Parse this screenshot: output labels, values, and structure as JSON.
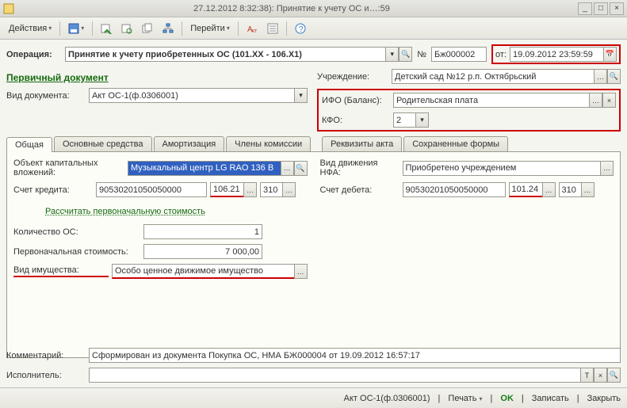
{
  "titlebar": {
    "left_fragment": "",
    "right_fragment": "27.12.2012 8:32:38): Принятие к учету ОС и…:59"
  },
  "toolbar": {
    "actions": "Действия",
    "goto": "Перейти"
  },
  "header": {
    "operation_label": "Операция:",
    "operation_value": "Принятие к учету приобретенных ОС (101.XX - 106.X1)",
    "num_label": "№",
    "num_value": "Бж000002",
    "from_label": "от:",
    "from_value": "19.09.2012 23:59:59"
  },
  "primary_doc_title": "Первичный документ",
  "doc_type": {
    "label": "Вид документа:",
    "value": "Акт ОС-1(ф.0306001)"
  },
  "inst": {
    "label": "Учреждение:",
    "value": "Детский сад №12 р.п. Октябрьский"
  },
  "ifo": {
    "label": "ИФО (Баланс):",
    "value": "Родительская плата"
  },
  "kfo": {
    "label": "КФО:",
    "value": "2"
  },
  "tabs": {
    "general": "Общая",
    "os": "Основные средства",
    "amort": "Амортизация",
    "members": "Члены комиссии",
    "req": "Реквизиты акта",
    "saved": "Сохраненные формы"
  },
  "general_tab": {
    "obj_label": "Объект капитальных вложений:",
    "obj_value": "Музыкальный центр LG  RAO 136 В",
    "credit_label": "Счет кредита:",
    "credit_acct": "90530201050050000",
    "credit_sub": "106.21",
    "credit_code": "310",
    "move_label": "Вид движения НФА:",
    "move_value": "Приобретено учреждением",
    "debit_label": "Счет дебета:",
    "debit_acct": "90530201050050000",
    "debit_sub": "101.24",
    "debit_code": "310",
    "recalc_link": "Рассчитать первоначальную стоимость",
    "qty_label": "Количество ОС:",
    "qty_value": "1",
    "cost_label": "Первоначальная стоимость:",
    "cost_value": "7 000,00",
    "prop_label": "Вид имущества:",
    "prop_value": "Особо ценное движимое имущество"
  },
  "comment": {
    "label": "Комментарий:",
    "value": "Сформирован из документа Покупка ОС, НМА БЖ000004 от 19.09.2012 16:57:17"
  },
  "executor_label": "Исполнитель:",
  "footer": {
    "form": "Акт ОС-1(ф.0306001)",
    "print": "Печать",
    "ok": "OK",
    "write": "Записать",
    "close": "Закрыть"
  }
}
